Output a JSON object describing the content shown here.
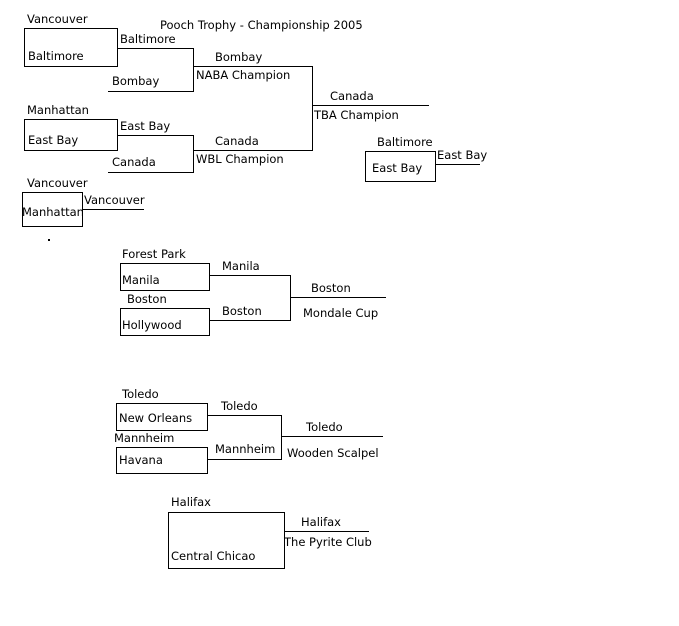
{
  "title": "Pooch Trophy - Championship 2005",
  "bracket": {
    "naba_region": {
      "round1": [
        {
          "top": "Vancouver",
          "bottom": "Baltimore",
          "winner": "Baltimore"
        },
        {
          "top": "Manhattan",
          "bottom": "East Bay",
          "winner": "East Bay"
        }
      ],
      "round2": [
        {
          "top": "Baltimore",
          "bottom": "Bombay",
          "winner": "Bombay",
          "winner_sub": "NABA Champion"
        },
        {
          "top": "East Bay",
          "bottom": "Canada",
          "winner": "Canada",
          "winner_sub": "WBL Champion"
        }
      ],
      "final": {
        "winner": "Canada",
        "winner_sub": "TBA Champion"
      },
      "consolation": {
        "top": "Vancouver",
        "bottom": "Manhattan",
        "winner": "Vancouver"
      },
      "third_place": {
        "top": "Baltimore",
        "bottom": "East Bay",
        "winner": "East Bay"
      }
    },
    "mondale_cup": {
      "round1": [
        {
          "top": "Forest Park",
          "bottom": "Manila",
          "winner": "Manila"
        },
        {
          "top": "Boston",
          "bottom": "Hollywood",
          "winner": "Boston"
        }
      ],
      "final": {
        "winner": "Boston",
        "winner_sub": "Mondale Cup"
      }
    },
    "wooden_scalpel": {
      "round1": [
        {
          "top": "Toledo",
          "bottom": "New Orleans",
          "winner": "Toledo"
        },
        {
          "top": "Mannheim",
          "bottom": "Havana",
          "winner": "Mannheim"
        }
      ],
      "final": {
        "winner": "Toledo",
        "winner_sub": "Wooden Scalpel"
      }
    },
    "pyrite_club": {
      "round1": [
        {
          "top": "Halifax",
          "bottom": "Central Chicao",
          "winner": "Halifax"
        }
      ],
      "final": {
        "winner": "Halifax",
        "winner_sub": "The Pyrite Club"
      }
    }
  }
}
